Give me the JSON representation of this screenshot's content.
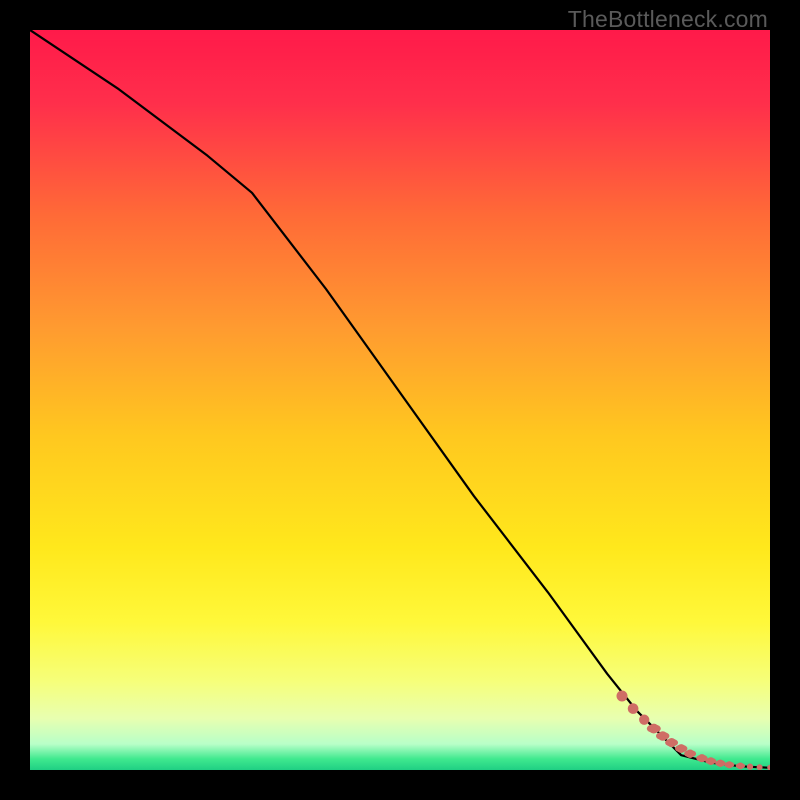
{
  "watermark": "TheBottleneck.com",
  "colors": {
    "bg": "#000000",
    "line": "#000000",
    "dots": "#cf6d65",
    "gradient_stops": [
      {
        "offset": 0.0,
        "color": "#ff1a4a"
      },
      {
        "offset": 0.1,
        "color": "#ff2f4b"
      },
      {
        "offset": 0.25,
        "color": "#ff6a37"
      },
      {
        "offset": 0.4,
        "color": "#ff9a30"
      },
      {
        "offset": 0.55,
        "color": "#ffc81f"
      },
      {
        "offset": 0.7,
        "color": "#ffe81c"
      },
      {
        "offset": 0.8,
        "color": "#fff83a"
      },
      {
        "offset": 0.88,
        "color": "#f6ff7a"
      },
      {
        "offset": 0.93,
        "color": "#e8ffb0"
      },
      {
        "offset": 0.965,
        "color": "#b8ffc8"
      },
      {
        "offset": 0.985,
        "color": "#40e98f"
      },
      {
        "offset": 1.0,
        "color": "#1fcf84"
      }
    ]
  },
  "chart_data": {
    "type": "line",
    "title": "",
    "xlabel": "",
    "ylabel": "",
    "xlim": [
      0,
      100
    ],
    "ylim": [
      0,
      100
    ],
    "series": [
      {
        "name": "bottleneck-curve",
        "x": [
          0,
          12,
          24,
          30,
          40,
          50,
          60,
          70,
          78,
          82,
          85,
          88,
          92,
          96,
          100
        ],
        "y": [
          100,
          92,
          83,
          78,
          65,
          51,
          37,
          24,
          13,
          8,
          5,
          2,
          1,
          0.5,
          0.3
        ]
      }
    ],
    "dots": {
      "name": "highlight-segment",
      "x": [
        80.0,
        81.5,
        83.0,
        84.3,
        85.5,
        86.7,
        88.0,
        89.2,
        90.8,
        92.0,
        93.3,
        94.5,
        96.0,
        97.3,
        98.6,
        100.0
      ],
      "y": [
        10.0,
        8.3,
        6.8,
        5.6,
        4.6,
        3.7,
        2.9,
        2.2,
        1.6,
        1.2,
        0.9,
        0.7,
        0.55,
        0.45,
        0.38,
        0.32
      ]
    }
  }
}
